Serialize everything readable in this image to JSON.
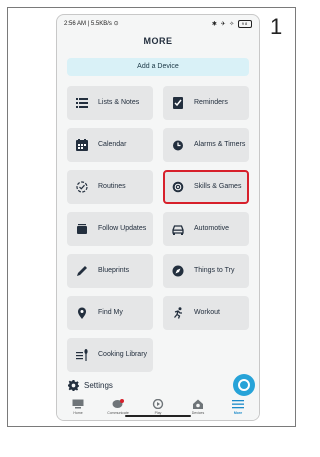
{
  "step_number": "1",
  "status_bar": {
    "time": "2:56 AM | 5.5KB/s ⊙",
    "icons": "✱ ✈ ✧",
    "battery": "98"
  },
  "page_title": "MORE",
  "add_device_label": "Add a Device",
  "tiles": [
    {
      "label": "Lists & Notes",
      "icon": "list-icon"
    },
    {
      "label": "Reminders",
      "icon": "reminder-icon"
    },
    {
      "label": "Calendar",
      "icon": "calendar-icon"
    },
    {
      "label": "Alarms & Timers",
      "icon": "alarm-icon"
    },
    {
      "label": "Routines",
      "icon": "routines-icon"
    },
    {
      "label": "Skills & Games",
      "icon": "skills-icon",
      "highlighted": true
    },
    {
      "label": "Follow Updates",
      "icon": "follow-icon"
    },
    {
      "label": "Automotive",
      "icon": "car-icon"
    },
    {
      "label": "Blueprints",
      "icon": "blueprint-icon"
    },
    {
      "label": "Things to Try",
      "icon": "compass-icon"
    },
    {
      "label": "Find My",
      "icon": "location-pin-icon"
    },
    {
      "label": "Workout",
      "icon": "workout-icon"
    },
    {
      "label": "Cooking Library",
      "icon": "cooking-icon"
    }
  ],
  "settings_label": "Settings",
  "nav": [
    {
      "label": "Home",
      "icon": "home-icon"
    },
    {
      "label": "Communicate",
      "icon": "chat-icon"
    },
    {
      "label": "Play",
      "icon": "play-icon"
    },
    {
      "label": "Devices",
      "icon": "devices-icon"
    },
    {
      "label": "More",
      "icon": "menu-icon",
      "active": true
    }
  ],
  "colors": {
    "highlight": "#d7202b",
    "accent": "#27a3d8",
    "tile": "#e5e6e7",
    "add_device_bg": "#d9f1f7"
  }
}
